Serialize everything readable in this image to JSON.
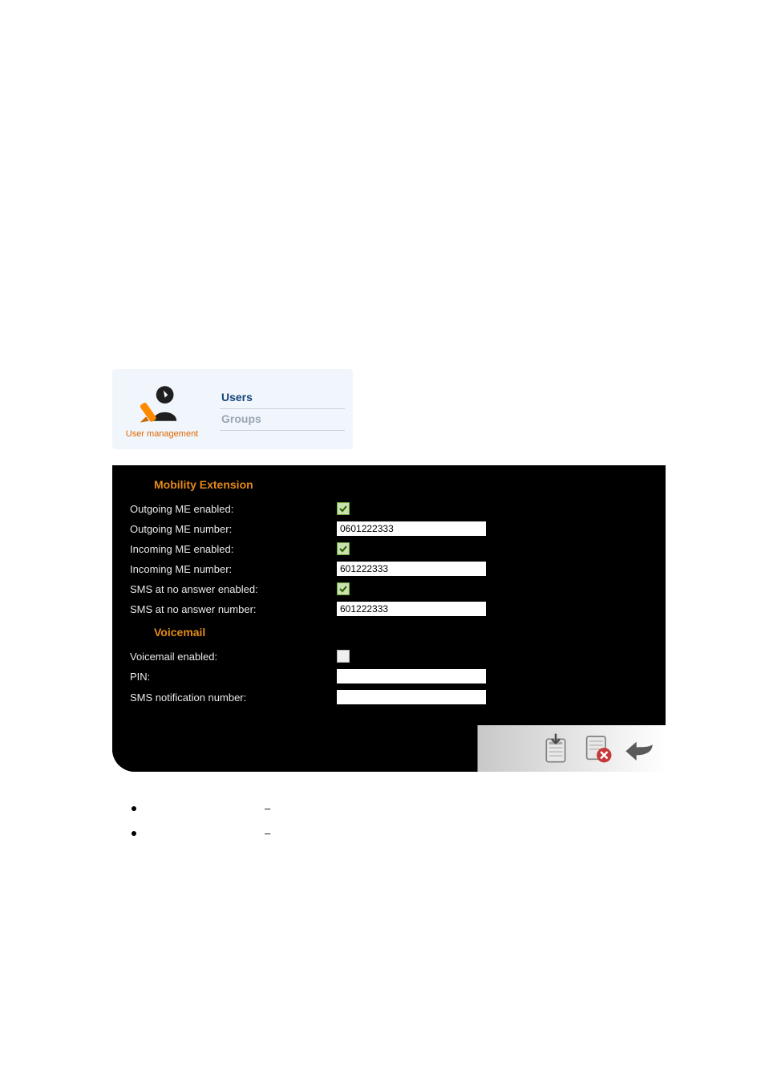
{
  "nav": {
    "icon_label": "User management",
    "links": {
      "users": "Users",
      "groups": "Groups"
    }
  },
  "sections": {
    "mobility": "Mobility Extension",
    "voicemail": "Voicemail"
  },
  "labels": {
    "outgoing_me_enabled": "Outgoing ME enabled:",
    "outgoing_me_number": "Outgoing ME number:",
    "incoming_me_enabled": "Incoming ME enabled:",
    "incoming_me_number": "Incoming ME number:",
    "sms_noanswer_enabled": "SMS at no answer enabled:",
    "sms_noanswer_number": "SMS at no answer number:",
    "voicemail_enabled": "Voicemail enabled:",
    "pin": "PIN:",
    "sms_notification_number": "SMS notification number:"
  },
  "values": {
    "outgoing_me_number": "0601222333",
    "incoming_me_number": "601222333",
    "sms_noanswer_number": "601222333",
    "pin": "",
    "sms_notification_number": ""
  },
  "checks": {
    "outgoing_me_enabled": true,
    "incoming_me_enabled": true,
    "sms_noanswer_enabled": true,
    "voicemail_enabled": false
  },
  "bullets": {
    "dash": "–"
  }
}
